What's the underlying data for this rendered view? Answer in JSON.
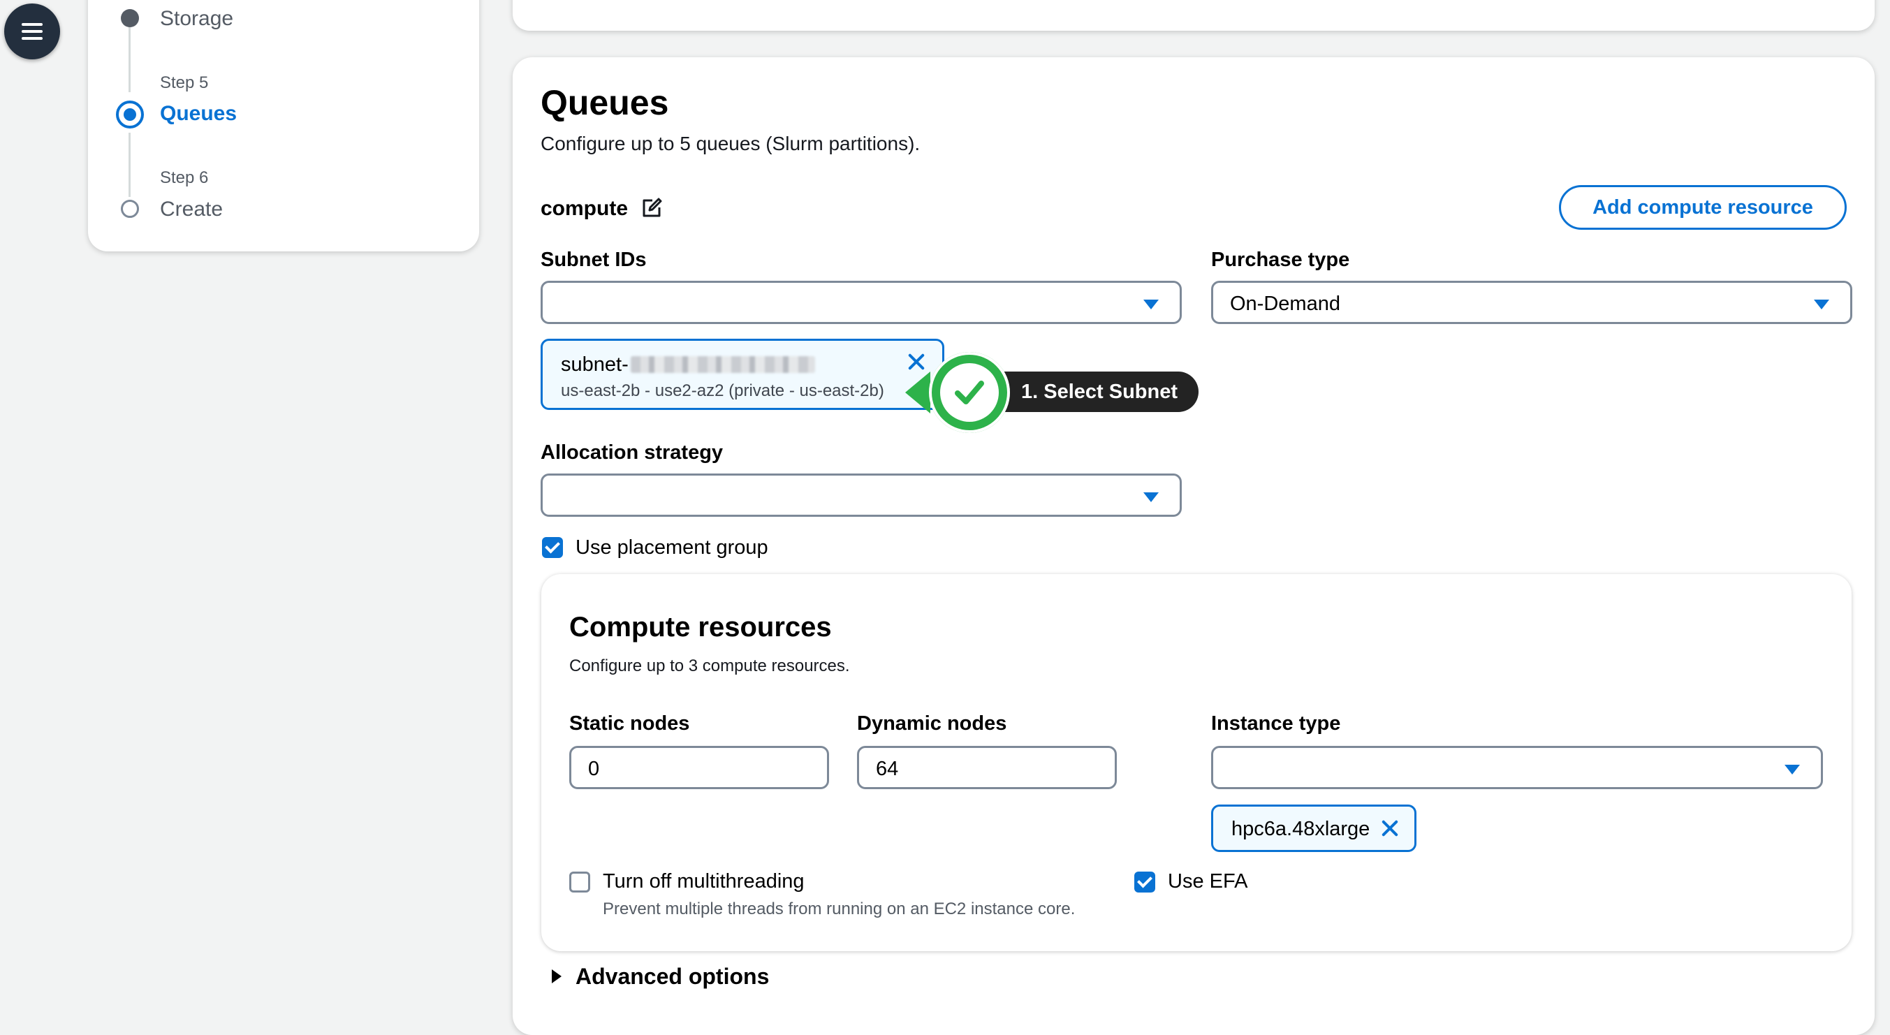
{
  "steps": [
    {
      "label": "Storage"
    },
    {
      "small": "Step 5",
      "label": "Queues"
    },
    {
      "small": "Step 6",
      "label": "Create"
    }
  ],
  "queues": {
    "title": "Queues",
    "description": "Configure up to 5 queues (Slurm partitions).",
    "queue_name": "compute",
    "add_compute_resource": "Add compute resource",
    "subnet_ids_label": "Subnet IDs",
    "subnet_ids_value": "",
    "subnet_token": {
      "name_prefix": "subnet-",
      "detail": "us-east-2b - use2-az2 (private - us-east-2b)"
    },
    "purchase_type_label": "Purchase type",
    "purchase_type_value": "On-Demand",
    "allocation_strategy_label": "Allocation strategy",
    "allocation_strategy_value": "",
    "use_placement_group": {
      "label": "Use placement group",
      "checked": true
    },
    "advanced_options": "Advanced options"
  },
  "compute_resources": {
    "title": "Compute resources",
    "description": "Configure up to 3 compute resources.",
    "static_nodes_label": "Static nodes",
    "static_nodes_value": "0",
    "dynamic_nodes_label": "Dynamic nodes",
    "dynamic_nodes_value": "64",
    "instance_type_label": "Instance type",
    "instance_type_value": "",
    "instance_token": "hpc6a.48xlarge",
    "multithreading": {
      "label": "Turn off multithreading",
      "help": "Prevent multiple threads from running on an EC2 instance core.",
      "checked": false
    },
    "use_efa": {
      "label": "Use EFA",
      "checked": true
    }
  },
  "annotation": {
    "text": "1. Select Subnet",
    "color": "#2db24a"
  },
  "colors": {
    "accent": "#0972d3",
    "dark": "#232f3e"
  }
}
